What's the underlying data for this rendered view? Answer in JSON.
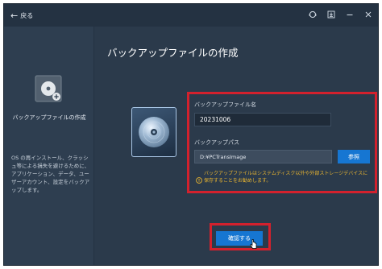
{
  "titlebar": {
    "back_arrow": "←",
    "back_label": "戻る",
    "controls": [
      "support-icon",
      "minimize-to-tray-icon",
      "minimize-icon",
      "close-icon"
    ]
  },
  "sidebar": {
    "icon": "disk-add-icon",
    "title": "バックアップファイルの作成",
    "description": "OS の再インストール、クラッシュ等による損失を避けるために、アプリケーション、データ、ユーザーアカウント、設定をバックアップします。"
  },
  "main": {
    "title": "バックアップファイルの作成",
    "disk_icon": "backup-disk-icon",
    "name_label": "バックアップファイル名",
    "name_value": "20231006",
    "path_label": "バックアップパス",
    "path_value": "D:¥PCTransImage",
    "browse_label": "参照",
    "warning_icon": "warning-icon",
    "warning_text": "バックアップファイルはシステムディスク以外や外部ストレージデバイスに保存することをお勧めします。",
    "confirm_label": "確認する"
  },
  "colors": {
    "background": "#2b3a4b",
    "accent": "#1676d2",
    "highlight": "#d3212d",
    "warning": "#e8b430"
  }
}
